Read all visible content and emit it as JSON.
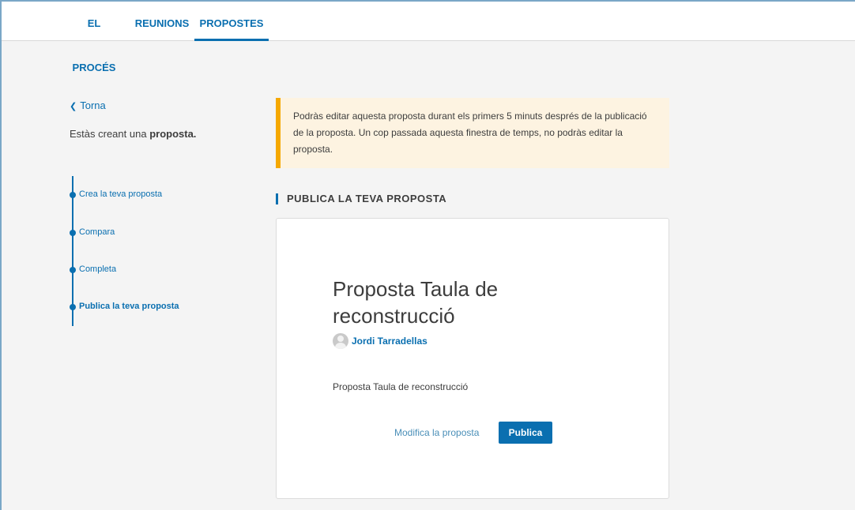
{
  "nav": {
    "tabs": [
      {
        "label": "EL PROCÉS"
      },
      {
        "label": "REUNIONS"
      },
      {
        "label": "PROPOSTES",
        "active": true
      }
    ]
  },
  "sidebar": {
    "back_label": "Torna",
    "creating_prefix": "Estàs creant una",
    "creating_bold": "proposta.",
    "steps": [
      {
        "label": "Crea la teva proposta"
      },
      {
        "label": "Compara"
      },
      {
        "label": "Completa"
      },
      {
        "label": "Publica la teva proposta",
        "current": true
      }
    ]
  },
  "callout": {
    "text": "Podràs editar aquesta proposta durant els primers 5 minuts després de la publicació de la proposta. Un cop passada aquesta finestra de temps, no podràs editar la proposta.",
    "accent_color": "#f5a800"
  },
  "main": {
    "section_title": "PUBLICA LA TEVA PROPOSTA",
    "proposal": {
      "title": "Proposta Taula de reconstrucció",
      "author": "Jordi Tarradellas",
      "body": "Proposta Taula de reconstrucció"
    },
    "actions": {
      "modify_label": "Modifica la proposta",
      "publish_label": "Publica"
    }
  },
  "colors": {
    "primary": "#0a6fb0",
    "background": "#f4f4f4"
  }
}
